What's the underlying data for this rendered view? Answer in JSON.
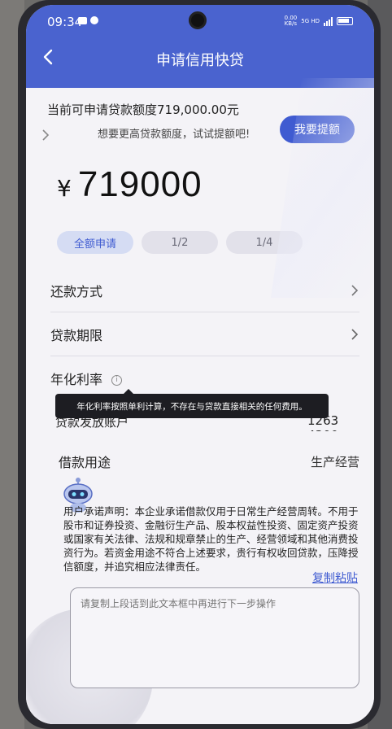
{
  "status": {
    "time": "09:34",
    "net_speed": "0.00\nKB/s",
    "network": "5G HD"
  },
  "header": {
    "title": "申请信用快贷",
    "back_icon": "chevron-left-icon"
  },
  "quota": {
    "text": "当前可申请贷款额度719,000.00元",
    "raise_hint": "想要更高贷款额度，试试提额吧!",
    "raise_button": "我要提额"
  },
  "amount": {
    "currency": "¥",
    "value": "719000"
  },
  "chips": [
    {
      "label": "全额申请",
      "active": true
    },
    {
      "label": "1/2",
      "active": false
    },
    {
      "label": "1/4",
      "active": false
    }
  ],
  "rows": {
    "repay_method": {
      "label": "还款方式"
    },
    "term": {
      "label": "贷款期限"
    },
    "rate": {
      "label": "年化利率"
    },
    "purpose": {
      "label": "借款用途",
      "value": "生产经营"
    }
  },
  "tooltip": "年化利率按照单利计算，不存在与贷款直接相关的任何费用。",
  "repay_amount": {
    "label": "贷款发放账户",
    "value": "1263   4300"
  },
  "statement": "用户承诺声明：本企业承诺借款仅用于日常生产经营周转。不用于股市和证券投资、金融衍生产品、股本权益性投资、固定资产投资或国家有关法律、法规和规章禁止的生产、经营领域和其他消费投资行为。若资金用途不符合上述要求，贵行有权收回贷款，压降授信额度，并追究相应法律责任。",
  "copy_link": "复制粘贴",
  "textbox": {
    "placeholder": "请复制上段话到此文本框中再进行下一步操作"
  },
  "colors": {
    "primary": "#4a63cf",
    "button": "#3f5bd1",
    "background": "#f4f3f7"
  }
}
